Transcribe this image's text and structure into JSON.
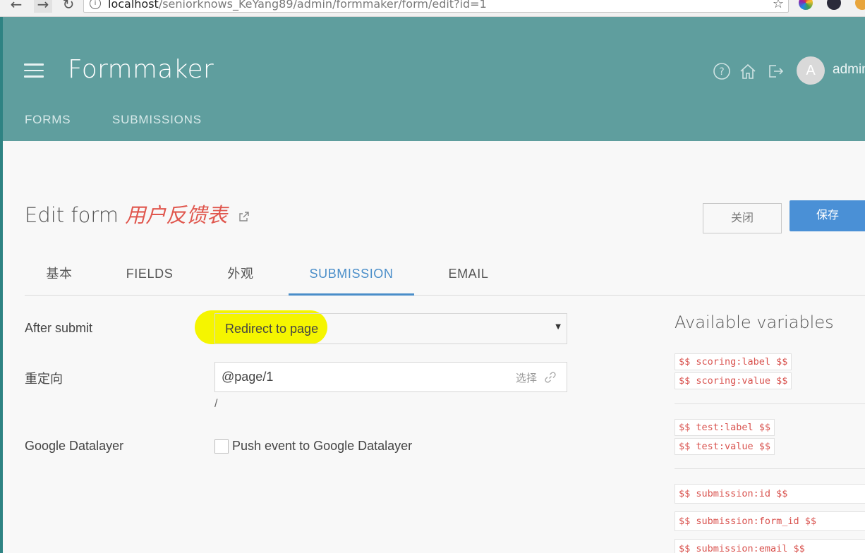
{
  "browser": {
    "url_host": "localhost",
    "url_path": "/seniorknows_KeYang89/admin/formmaker/form/edit?id=1"
  },
  "header": {
    "app_title": "Formmaker",
    "avatar_initial": "A",
    "username": "admin",
    "nav": [
      "FORMS",
      "SUBMISSIONS"
    ]
  },
  "page": {
    "title_prefix": "Edit form",
    "form_name": "用户反馈表",
    "close_label": "关闭",
    "save_label": "保存"
  },
  "tabs": [
    {
      "label": "基本",
      "active": false
    },
    {
      "label": "FIELDS",
      "active": false
    },
    {
      "label": "外观",
      "active": false
    },
    {
      "label": "SUBMISSION",
      "active": true
    },
    {
      "label": "EMAIL",
      "active": false
    }
  ],
  "form": {
    "after_submit_label": "After submit",
    "after_submit_value": "Redirect to page",
    "redirect_label": "重定向",
    "redirect_value": "@page/1",
    "redirect_pick": "选择",
    "redirect_hint": "/",
    "datalayer_label": "Google Datalayer",
    "datalayer_checkbox_label": "Push event to Google Datalayer",
    "datalayer_checked": false
  },
  "variables": {
    "title": "Available variables",
    "groups": [
      [
        "$$ scoring:label $$",
        "$$ scoring:value $$"
      ],
      [
        "$$ test:label $$",
        "$$ test:value $$"
      ],
      [
        "$$ submission:id $$",
        "$$ submission:form_id $$",
        "$$ submission:email $$"
      ]
    ]
  },
  "colors": {
    "header_bg": "#5f9e9e",
    "accent_blue": "#4a90d6",
    "form_name_red": "#e0574e",
    "highlight_yellow": "#f5f500"
  }
}
